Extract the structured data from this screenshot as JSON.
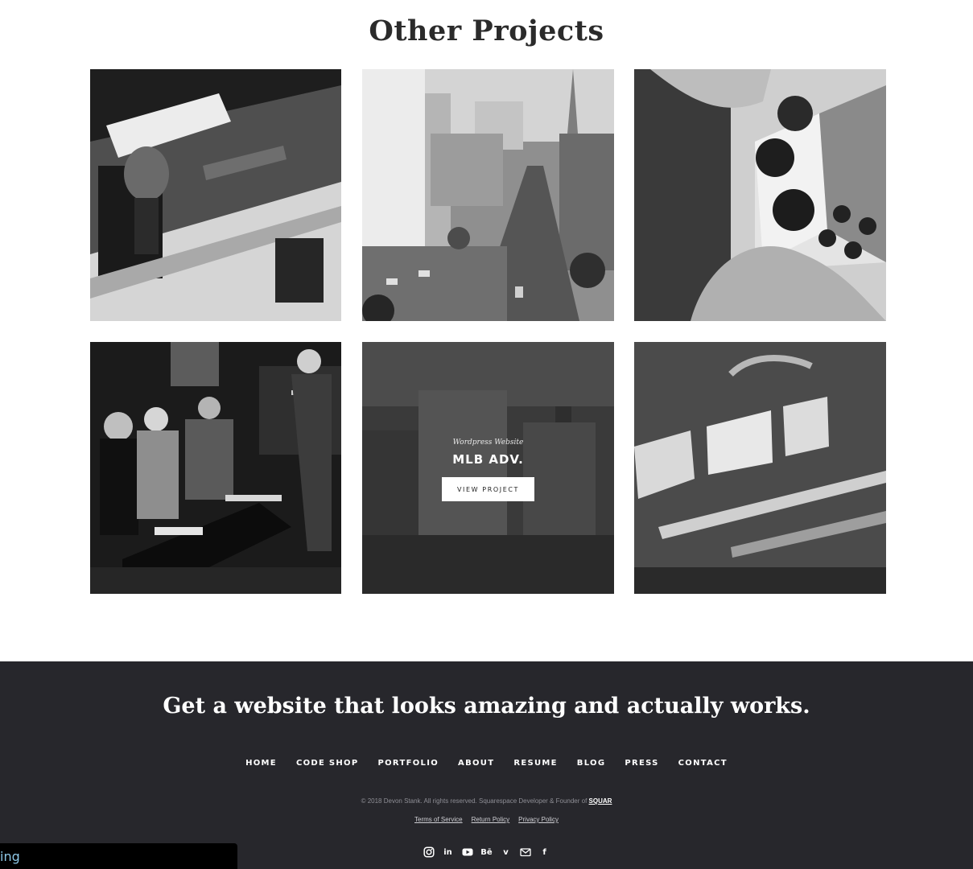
{
  "section": {
    "title": "Other Projects"
  },
  "projects": [
    {
      "image": "iron-man-poster-photo"
    },
    {
      "image": "city-street-aerial-photo"
    },
    {
      "image": "game-controller-photo"
    },
    {
      "image": "tv-panel-set-photo"
    },
    {
      "image": "city-buildings-photo",
      "hover": {
        "category": "Wordpress Website",
        "title": "MLB ADV.",
        "button": "VIEW PROJECT"
      }
    },
    {
      "image": "book-cover-typography-photo"
    }
  ],
  "footer": {
    "cta": "Get a website that looks amazing and actually works.",
    "nav": [
      "HOME",
      "CODE SHOP",
      "PORTFOLIO",
      "ABOUT",
      "RESUME",
      "BLOG",
      "PRESS",
      "CONTACT"
    ],
    "copyright": "© 2018 Devon Stank. All rights reserved. Squarespace Developer & Founder of",
    "copyright_brand": "SQUAR",
    "legal": [
      "Terms of Service",
      "Return Policy",
      "Privacy Policy"
    ],
    "social": [
      "instagram-icon",
      "linkedin-icon",
      "youtube-icon",
      "behance-icon",
      "vimeo-icon",
      "email-icon",
      "facebook-icon"
    ],
    "social_glyphs": {
      "linkedin": "in",
      "behance": "Bē",
      "vimeo": "v",
      "facebook": "f"
    },
    "colors": {
      "background": "#27272c",
      "text": "#ffffff",
      "muted": "#8e8e95"
    }
  },
  "status_overlay": {
    "text": "ing"
  }
}
